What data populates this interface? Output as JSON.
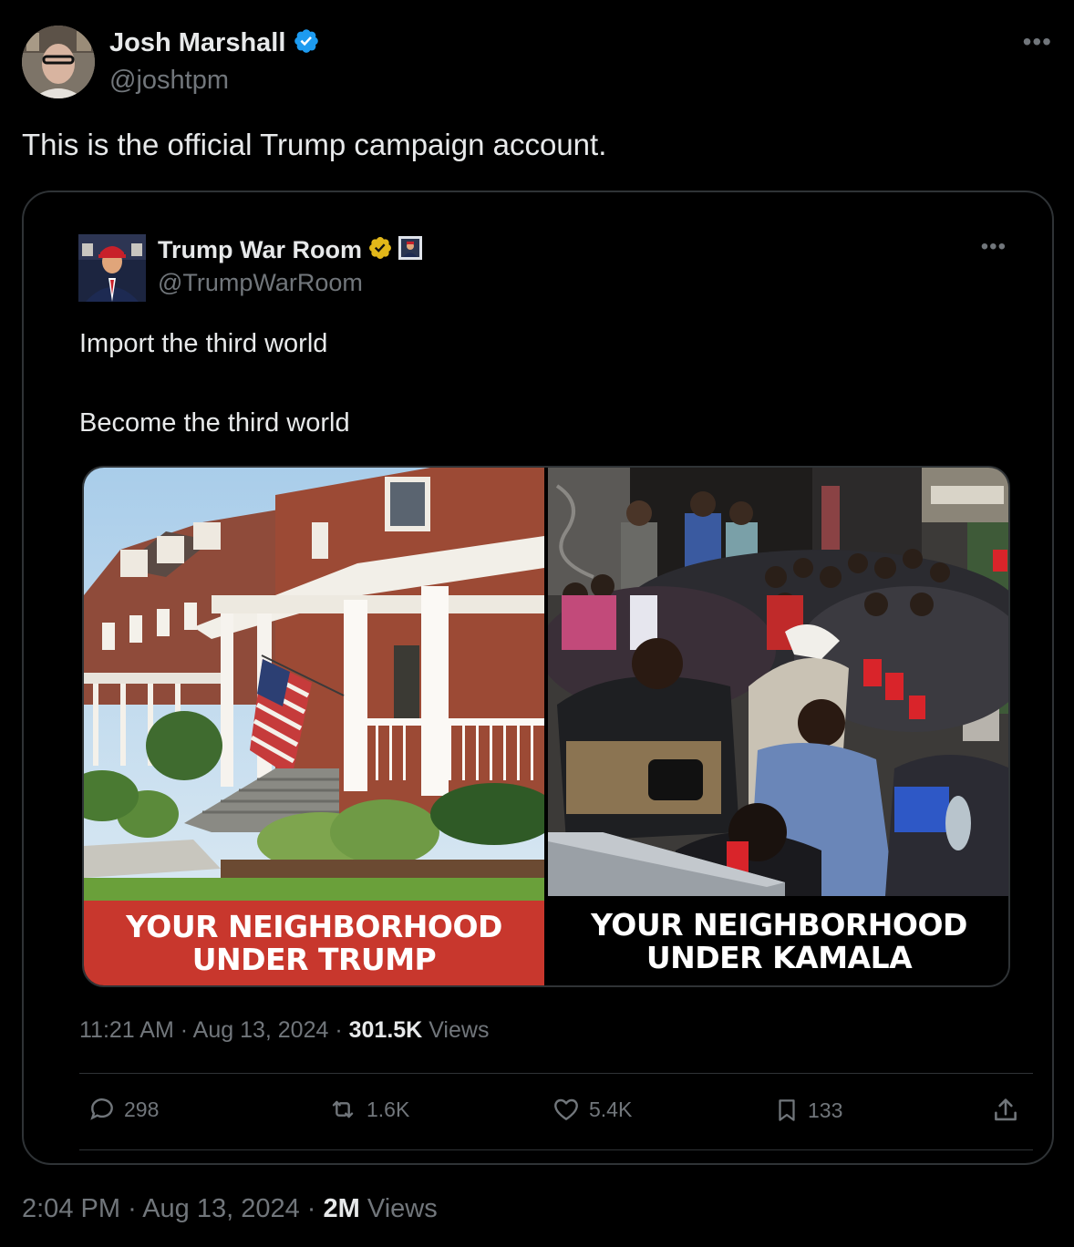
{
  "tweet": {
    "author": {
      "display_name": "Josh Marshall",
      "handle": "@joshtpm",
      "verified_color": "#1d9bf0"
    },
    "text": "This is the official Trump campaign account.",
    "time": "2:04 PM",
    "date": "Aug 13, 2024",
    "views_count": "2M",
    "views_label": "Views"
  },
  "quoted": {
    "author": {
      "display_name": "Trump War Room",
      "handle": "@TrumpWarRoom",
      "verified_color": "#e2b719"
    },
    "line1": "Import the third world",
    "line2": "Become the third world",
    "media": {
      "left_caption_1": "YOUR NEIGHBORHOOD",
      "left_caption_2": "UNDER TRUMP",
      "right_caption_1": "YOUR NEIGHBORHOOD",
      "right_caption_2": "UNDER KAMALA",
      "left_caption_bg": "#c8372d"
    },
    "time": "11:21 AM",
    "date": "Aug 13, 2024",
    "views_count": "301.5K",
    "views_label": "Views",
    "actions": {
      "replies": "298",
      "reposts": "1.6K",
      "likes": "5.4K",
      "bookmarks": "133"
    }
  },
  "icons": {
    "more": "more-horizontal-icon",
    "reply": "reply-icon",
    "repost": "repost-icon",
    "like": "heart-icon",
    "bookmark": "bookmark-icon",
    "share": "share-icon"
  }
}
